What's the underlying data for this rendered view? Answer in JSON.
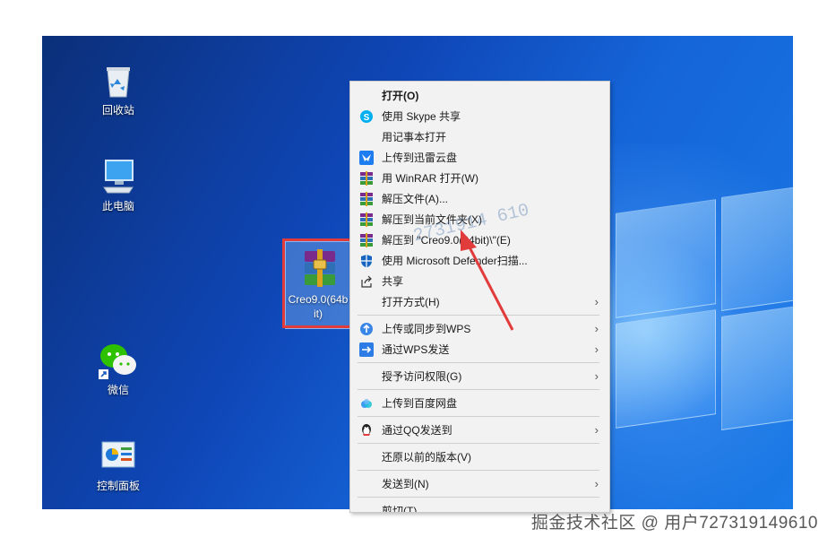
{
  "desktop_icons": [
    {
      "label": "回收站",
      "icon": "recycle-bin-icon"
    },
    {
      "label": "此电脑",
      "icon": "computer-icon"
    },
    {
      "label": "微信",
      "icon": "wechat-icon"
    },
    {
      "label": "控制面板",
      "icon": "control-panel-icon"
    }
  ],
  "selected_file": {
    "label_line1": "Creo9.0(64b",
    "label_line2": "it)",
    "icon": "winrar-archive-icon"
  },
  "context_menu": {
    "items": [
      {
        "label": "打开(O)",
        "icon": ""
      },
      {
        "label": "使用 Skype 共享",
        "icon": "skype-icon"
      },
      {
        "label": "用记事本打开",
        "icon": ""
      },
      {
        "label": "上传到迅雷云盘",
        "icon": "xunlei-icon"
      },
      {
        "label": "用 WinRAR 打开(W)",
        "icon": "winrar-icon"
      },
      {
        "label": "解压文件(A)...",
        "icon": "winrar-icon"
      },
      {
        "label": "解压到当前文件夹(X)",
        "icon": "winrar-icon"
      },
      {
        "label": "解压到 \"Creo9.0(64bit)\\\"(E)",
        "icon": "winrar-icon"
      },
      {
        "label": "使用 Microsoft Defender扫描...",
        "icon": "defender-icon"
      },
      {
        "label": "共享",
        "icon": "share-icon"
      },
      {
        "label": "打开方式(H)",
        "icon": ""
      },
      {
        "label": "上传或同步到WPS",
        "icon": "wps-cloud-icon"
      },
      {
        "label": "通过WPS发送",
        "icon": "wps-send-icon"
      },
      {
        "label": "授予访问权限(G)",
        "icon": ""
      },
      {
        "label": "上传到百度网盘",
        "icon": "baidu-netdisk-icon"
      },
      {
        "label": "通过QQ发送到",
        "icon": "qq-icon"
      },
      {
        "label": "还原以前的版本(V)",
        "icon": ""
      },
      {
        "label": "发送到(N)",
        "icon": ""
      },
      {
        "label": "剪切(T)",
        "icon": ""
      }
    ]
  },
  "watermark": "掘金技术社区 @ 用户727319149610",
  "stamp_text": "2731914 610",
  "colors": {
    "accent_red": "#e23b3b",
    "menu_bg": "#f2f2f2"
  }
}
